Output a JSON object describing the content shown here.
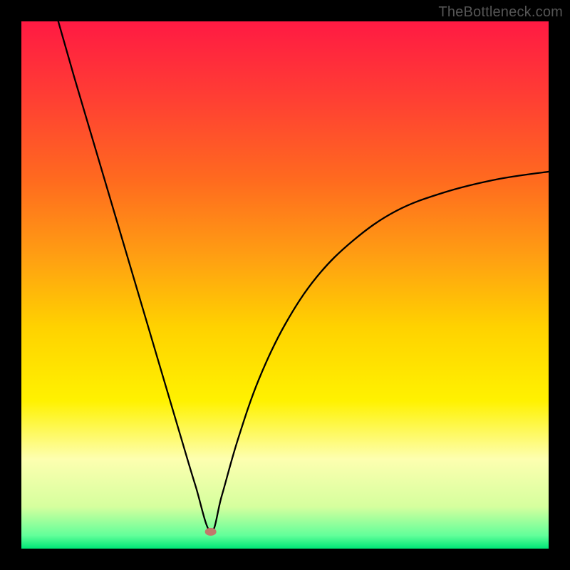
{
  "watermark": {
    "text": "TheBottleneck.com"
  },
  "chart_data": {
    "type": "line",
    "title": "",
    "xlabel": "",
    "ylabel": "",
    "xlim": [
      0,
      100
    ],
    "ylim": [
      0,
      100
    ],
    "grid": false,
    "legend": false,
    "annotations": [],
    "optimum_x": 35.9,
    "marker": {
      "x": 35.9,
      "y": 3.2,
      "color": "#c2786b"
    },
    "background_gradient_stops": [
      {
        "pos": 0.0,
        "color": "#ff1a43"
      },
      {
        "pos": 0.14,
        "color": "#ff3d34"
      },
      {
        "pos": 0.3,
        "color": "#ff6a1f"
      },
      {
        "pos": 0.45,
        "color": "#ffa012"
      },
      {
        "pos": 0.58,
        "color": "#ffd200"
      },
      {
        "pos": 0.72,
        "color": "#fff200"
      },
      {
        "pos": 0.83,
        "color": "#fdffb0"
      },
      {
        "pos": 0.92,
        "color": "#d6ff9e"
      },
      {
        "pos": 0.975,
        "color": "#62ff9a"
      },
      {
        "pos": 1.0,
        "color": "#00e676"
      }
    ],
    "series": [
      {
        "name": "left-branch",
        "x": [
          7.0,
          10,
          14,
          18,
          22,
          26,
          30,
          33,
          35.9
        ],
        "y": [
          100,
          89.5,
          76.0,
          62.5,
          49.0,
          35.5,
          22.0,
          12.0,
          3.2
        ]
      },
      {
        "name": "right-branch",
        "x": [
          35.9,
          38,
          41,
          45,
          50,
          56,
          63,
          71,
          80,
          90,
          100
        ],
        "y": [
          3.2,
          10.0,
          20.5,
          32.0,
          42.5,
          51.5,
          58.5,
          64.0,
          67.5,
          70.0,
          71.5
        ]
      }
    ]
  }
}
